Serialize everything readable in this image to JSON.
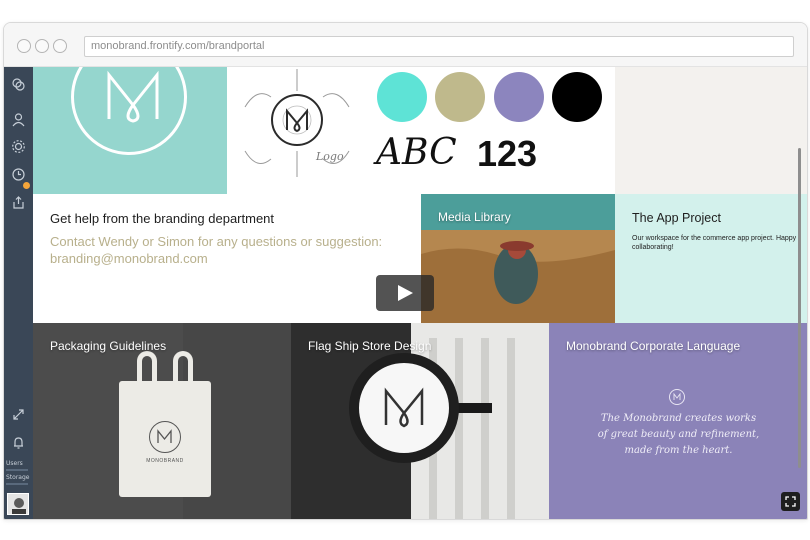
{
  "browser": {
    "url": "monobrand.frontify.com/brandportal"
  },
  "sidebar": {
    "icons": [
      "circles-icon",
      "users-icon",
      "gear-icon",
      "clock-icon",
      "share-icon",
      "expand-icon",
      "bell-icon"
    ],
    "users_label": "Users",
    "storage_label": "Storage"
  },
  "brand": {
    "colors": [
      "#5ee3d6",
      "#bfb98c",
      "#8c85be",
      "#000000"
    ],
    "type_sample": "ABC",
    "number_sample": "123",
    "sketch_label": "Logo"
  },
  "help": {
    "title": "Get help from the branding department",
    "line1": "Contact Wendy or Simon for any questions or suggestion:",
    "line2": "branding@monobrand.com"
  },
  "media": {
    "title": "Media Library"
  },
  "app_project": {
    "title": "The App Project",
    "description": "Our workspace for the commerce app project. Happy collaborating!"
  },
  "packaging": {
    "title": "Packaging Guidelines",
    "bag_text": "MONOBRAND"
  },
  "store": {
    "title": "Flag Ship Store Design"
  },
  "corporate": {
    "title": "Monobrand Corporate Language",
    "quote_line1": "The Monobrand creates works",
    "quote_line2": "of great beauty and refinement,",
    "quote_line3": "made from the heart."
  }
}
